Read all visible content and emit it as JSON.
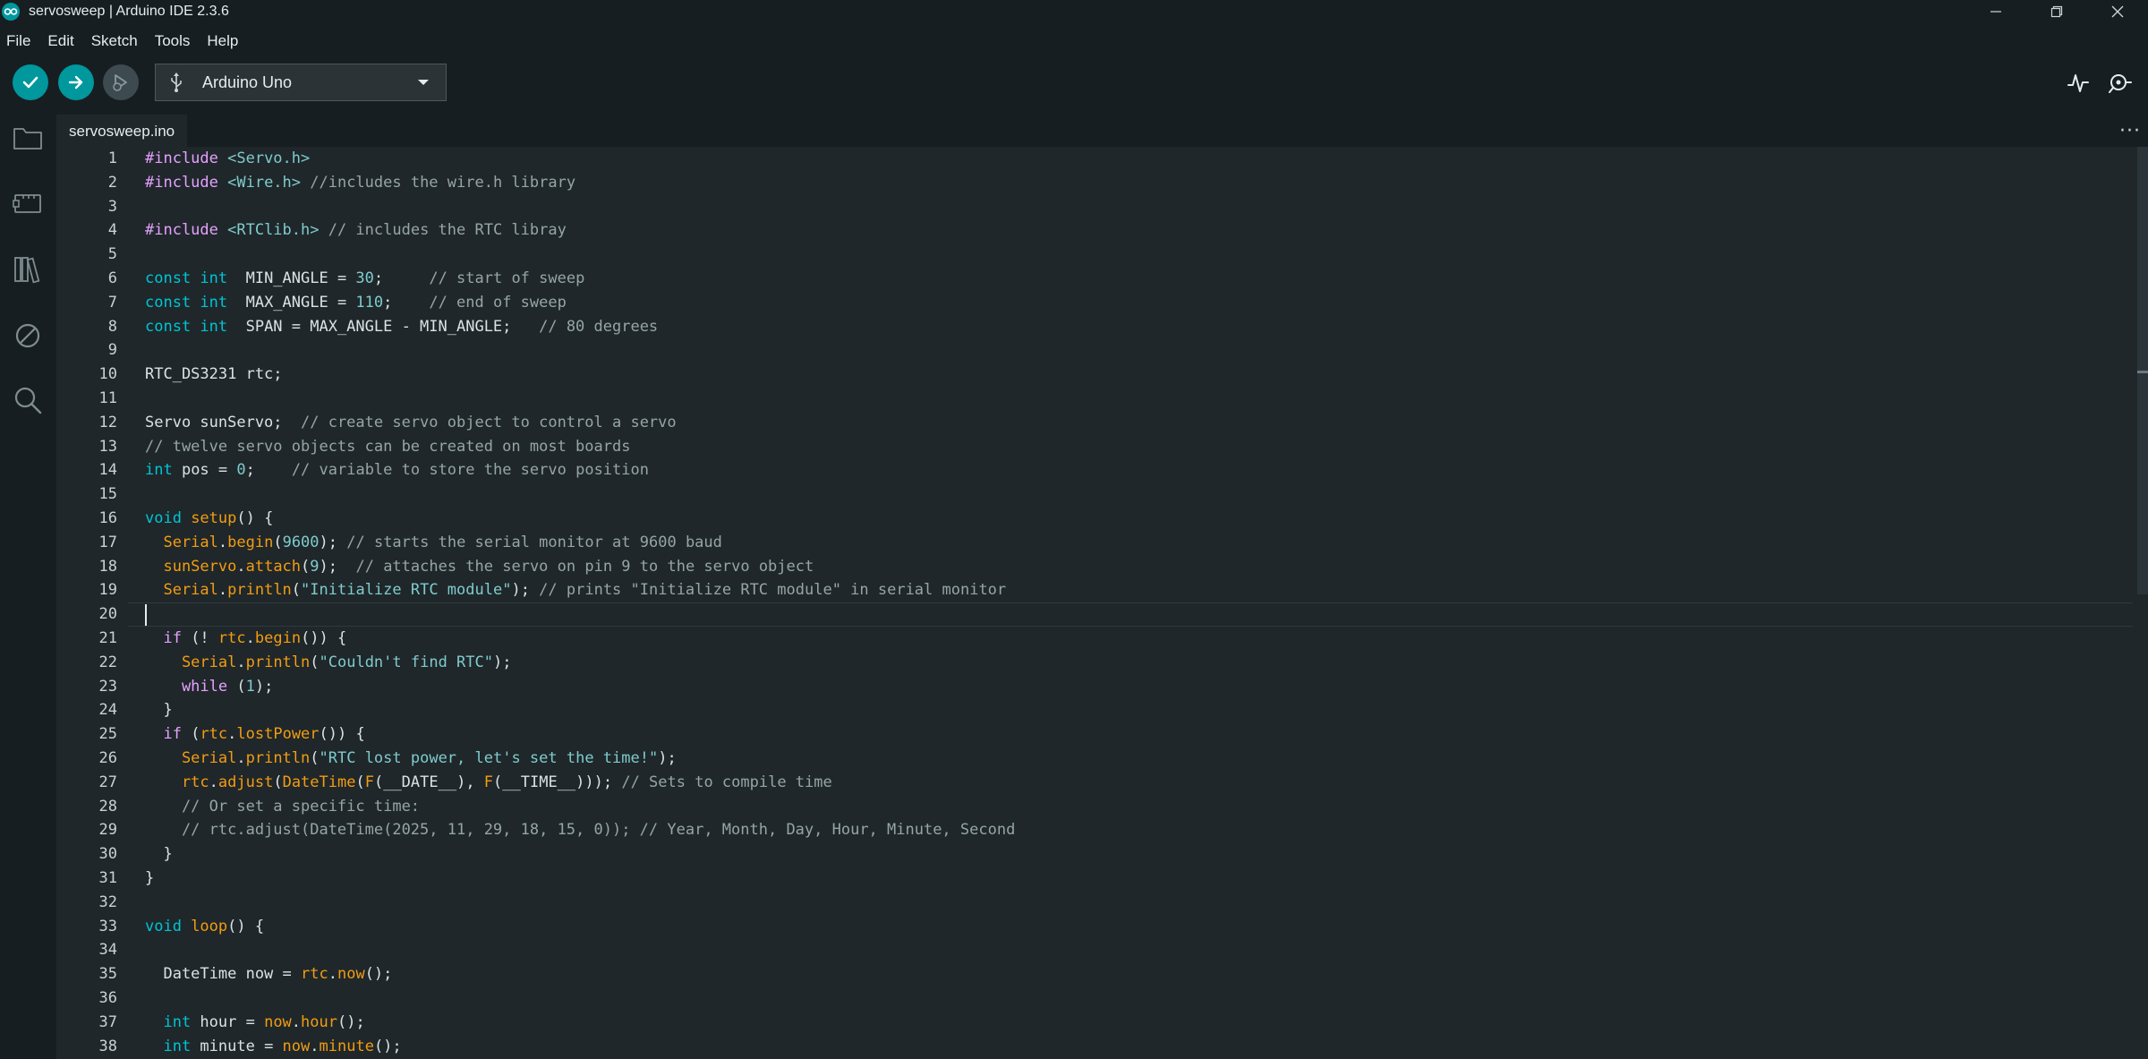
{
  "window": {
    "title": "servosweep | Arduino IDE 2.3.6"
  },
  "menu": {
    "items": [
      "File",
      "Edit",
      "Sketch",
      "Tools",
      "Help"
    ]
  },
  "toolbar": {
    "board": "Arduino Uno"
  },
  "tabs": [
    {
      "label": "servosweep.ino",
      "active": true
    }
  ],
  "editor": {
    "cursor_line": 20,
    "lines": [
      "1",
      "2",
      "3",
      "4",
      "5",
      "6",
      "7",
      "8",
      "9",
      "10",
      "11",
      "12",
      "13",
      "14",
      "15",
      "16",
      "17",
      "18",
      "19",
      "20",
      "21",
      "22",
      "23",
      "24",
      "25",
      "26",
      "27",
      "28",
      "29",
      "30",
      "31",
      "32",
      "33",
      "34",
      "35",
      "36",
      "37",
      "38"
    ],
    "code": [
      [
        [
          "pp",
          "#include "
        ],
        [
          "hdr",
          "<Servo.h>"
        ]
      ],
      [
        [
          "pp",
          "#include "
        ],
        [
          "hdr",
          "<Wire.h>"
        ],
        [
          "cm",
          " //includes the wire.h library"
        ]
      ],
      [],
      [
        [
          "pp",
          "#include "
        ],
        [
          "hdr",
          "<RTClib.h>"
        ],
        [
          "cm",
          " // includes the RTC libray"
        ]
      ],
      [],
      [
        [
          "ty",
          "const int"
        ],
        [
          "",
          "  MIN_ANGLE = "
        ],
        [
          "num",
          "30"
        ],
        [
          "",
          ";"
        ],
        [
          "cm",
          "     // start of sweep"
        ]
      ],
      [
        [
          "ty",
          "const int"
        ],
        [
          "",
          "  MAX_ANGLE = "
        ],
        [
          "num",
          "110"
        ],
        [
          "",
          ";"
        ],
        [
          "cm",
          "    // end of sweep"
        ]
      ],
      [
        [
          "ty",
          "const int"
        ],
        [
          "",
          "  SPAN = MAX_ANGLE - MIN_ANGLE;"
        ],
        [
          "cm",
          "   // 80 degrees"
        ]
      ],
      [],
      [
        [
          "",
          "RTC_DS3231 rtc;"
        ]
      ],
      [],
      [
        [
          "",
          "Servo sunServo;"
        ],
        [
          "cm",
          "  // create servo object to control a servo"
        ]
      ],
      [
        [
          "cm",
          "// twelve servo objects can be created on most boards"
        ]
      ],
      [
        [
          "ty",
          "int"
        ],
        [
          "",
          " pos = "
        ],
        [
          "num",
          "0"
        ],
        [
          "",
          ";"
        ],
        [
          "cm",
          "    // variable to store the servo position"
        ]
      ],
      [],
      [
        [
          "ty",
          "void"
        ],
        [
          "fn",
          " setup"
        ],
        [
          "",
          "() {"
        ]
      ],
      [
        [
          "fn",
          "  Serial"
        ],
        [
          "",
          "."
        ],
        [
          "fn",
          "begin"
        ],
        [
          "",
          "("
        ],
        [
          "num",
          "9600"
        ],
        [
          "",
          ");"
        ],
        [
          "cm",
          " // starts the serial monitor at 9600 baud"
        ]
      ],
      [
        [
          "fn",
          "  sunServo"
        ],
        [
          "",
          "."
        ],
        [
          "fn",
          "attach"
        ],
        [
          "",
          "("
        ],
        [
          "num",
          "9"
        ],
        [
          "",
          ");"
        ],
        [
          "cm",
          "  // attaches the servo on pin 9 to the servo object"
        ]
      ],
      [
        [
          "fn",
          "  Serial"
        ],
        [
          "",
          "."
        ],
        [
          "fn",
          "println"
        ],
        [
          "",
          "("
        ],
        [
          "str",
          "\"Initialize RTC module\""
        ],
        [
          "",
          ");"
        ],
        [
          "cm",
          " // prints \"Initialize RTC module\" in serial monitor"
        ]
      ],
      [],
      [
        [
          "kw",
          "  if"
        ],
        [
          "",
          " (! "
        ],
        [
          "fn",
          "rtc"
        ],
        [
          "",
          "."
        ],
        [
          "fn",
          "begin"
        ],
        [
          "",
          "()) {"
        ]
      ],
      [
        [
          "fn",
          "    Serial"
        ],
        [
          "",
          "."
        ],
        [
          "fn",
          "println"
        ],
        [
          "",
          "("
        ],
        [
          "str",
          "\"Couldn't find RTC\""
        ],
        [
          "",
          ");"
        ]
      ],
      [
        [
          "kw",
          "    while"
        ],
        [
          "",
          " ("
        ],
        [
          "num",
          "1"
        ],
        [
          "",
          ");"
        ]
      ],
      [
        [
          "",
          "  }"
        ]
      ],
      [
        [
          "kw",
          "  if"
        ],
        [
          "",
          " ("
        ],
        [
          "fn",
          "rtc"
        ],
        [
          "",
          "."
        ],
        [
          "fn",
          "lostPower"
        ],
        [
          "",
          "()) {"
        ]
      ],
      [
        [
          "fn",
          "    Serial"
        ],
        [
          "",
          "."
        ],
        [
          "fn",
          "println"
        ],
        [
          "",
          "("
        ],
        [
          "str",
          "\"RTC lost power, let's set the time!\""
        ],
        [
          "",
          ");"
        ]
      ],
      [
        [
          "fn",
          "    rtc"
        ],
        [
          "",
          "."
        ],
        [
          "fn",
          "adjust"
        ],
        [
          "",
          "("
        ],
        [
          "fn",
          "DateTime"
        ],
        [
          "",
          "("
        ],
        [
          "fn",
          "F"
        ],
        [
          "",
          "(__DATE__), "
        ],
        [
          "fn",
          "F"
        ],
        [
          "",
          "(__TIME__)));"
        ],
        [
          "cm",
          " // Sets to compile time"
        ]
      ],
      [
        [
          "cm",
          "    // Or set a specific time:"
        ]
      ],
      [
        [
          "cm",
          "    // rtc.adjust(DateTime(2025, 11, 29, 18, 15, 0)); // Year, Month, Day, Hour, Minute, Second"
        ]
      ],
      [
        [
          "",
          "  }"
        ]
      ],
      [
        [
          "",
          "}"
        ]
      ],
      [],
      [
        [
          "ty",
          "void"
        ],
        [
          "fn",
          " loop"
        ],
        [
          "",
          "() {"
        ]
      ],
      [],
      [
        [
          "",
          "  DateTime now = "
        ],
        [
          "fn",
          "rtc"
        ],
        [
          "",
          "."
        ],
        [
          "fn",
          "now"
        ],
        [
          "",
          "();"
        ]
      ],
      [],
      [
        [
          "ty",
          "  int"
        ],
        [
          "",
          "",
          " hour = "
        ],
        [
          "fn",
          "now"
        ],
        [
          "",
          "."
        ],
        [
          "fn",
          "hour"
        ],
        [
          "",
          "();"
        ]
      ],
      [
        [
          "ty",
          "  int"
        ],
        [
          "",
          " minute = "
        ],
        [
          "fn",
          "now"
        ],
        [
          "",
          "."
        ],
        [
          "fn",
          "minute"
        ],
        [
          "",
          "();"
        ]
      ]
    ]
  }
}
